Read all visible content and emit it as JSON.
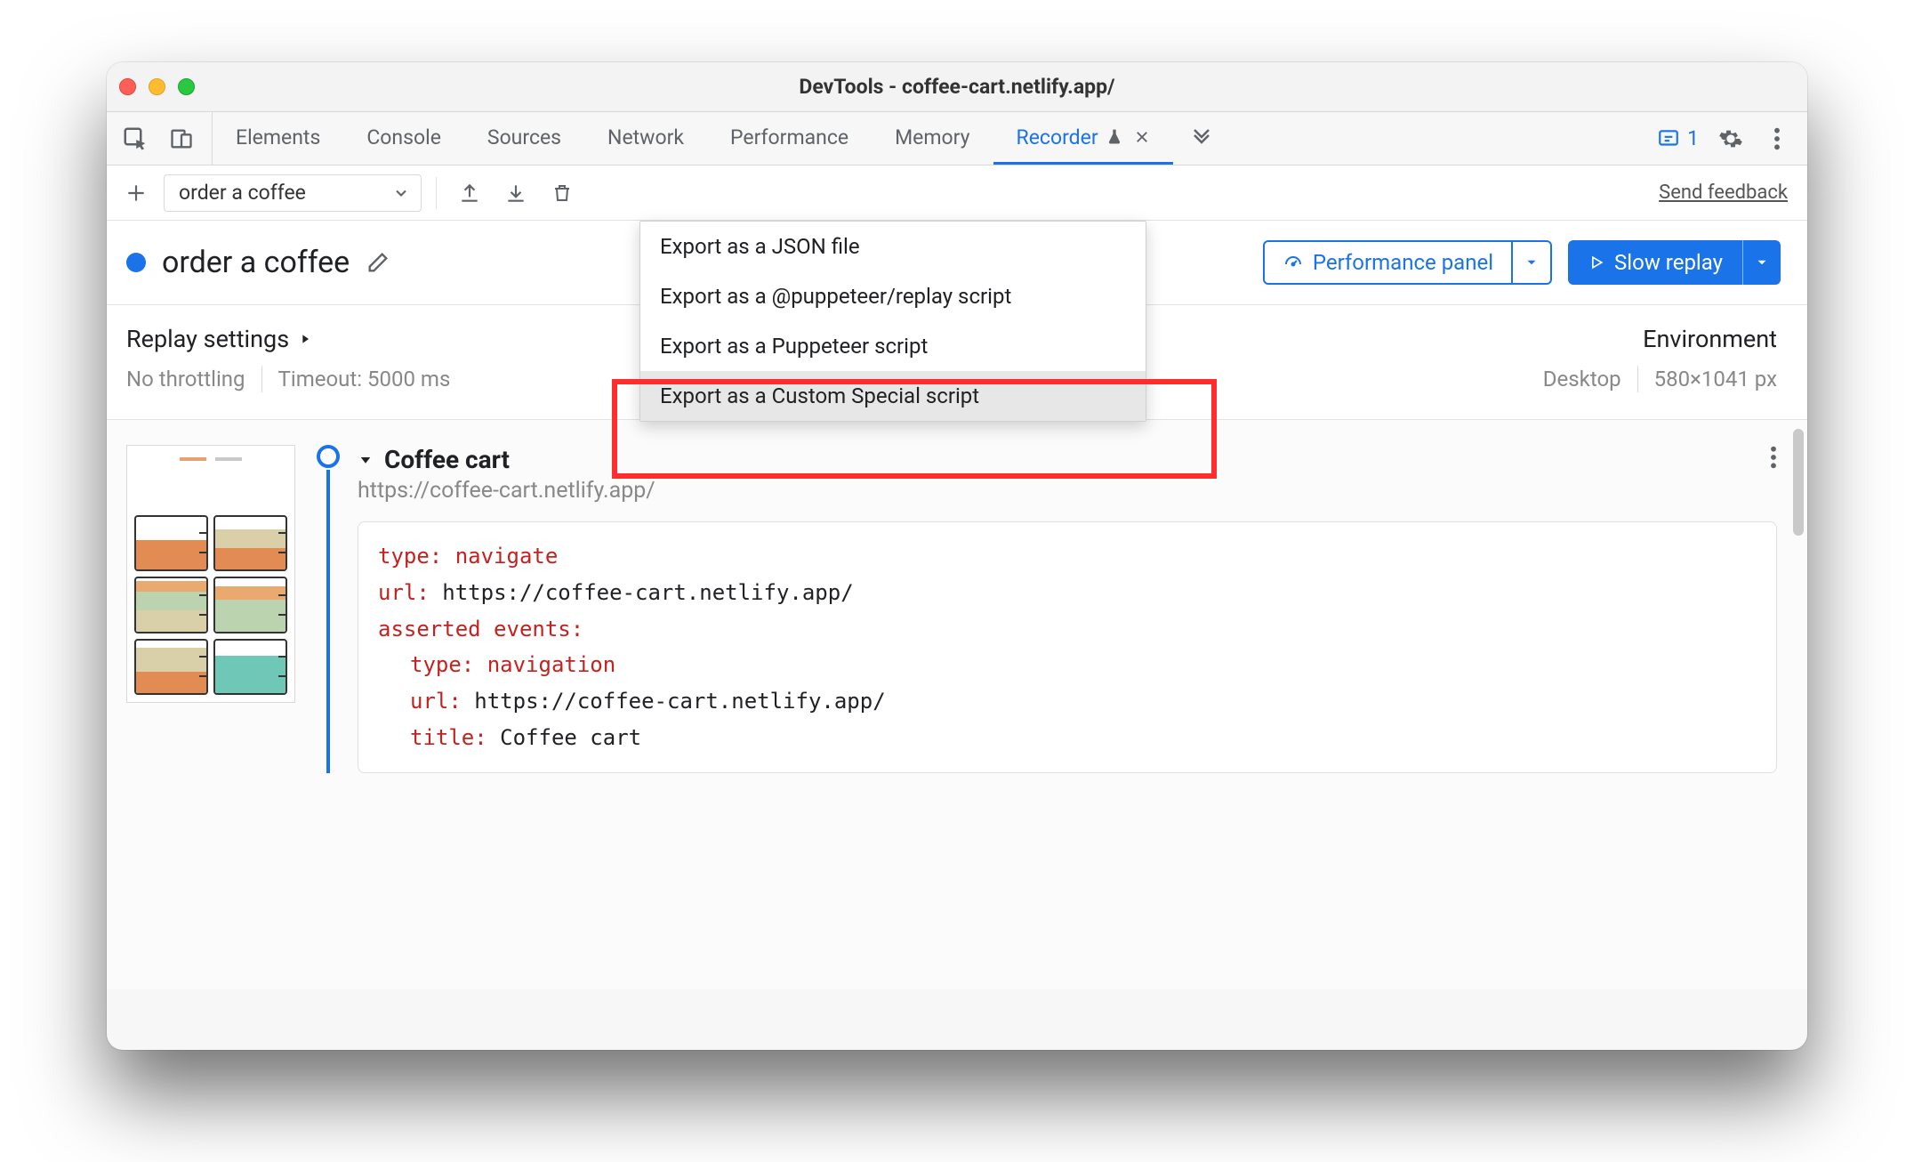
{
  "window": {
    "title": "DevTools - coffee-cart.netlify.app/"
  },
  "tabs": {
    "items": [
      "Elements",
      "Console",
      "Sources",
      "Network",
      "Performance",
      "Memory",
      "Recorder"
    ],
    "active_index": 6,
    "issues_count": "1"
  },
  "toolbar": {
    "recording_select": "order a coffee",
    "send_feedback": "Send feedback"
  },
  "header": {
    "recording_name": "order a coffee",
    "performance_btn": "Performance panel",
    "replay_btn": "Slow replay"
  },
  "settings": {
    "title": "Replay settings",
    "throttling": "No throttling",
    "timeout": "Timeout: 5000 ms"
  },
  "environment": {
    "title": "Environment",
    "device": "Desktop",
    "dimensions": "580×1041 px"
  },
  "export_menu": {
    "items": [
      "Export as a JSON file",
      "Export as a @puppeteer/replay script",
      "Export as a Puppeteer script",
      "Export as a Custom Special script"
    ],
    "highlighted_index": 3
  },
  "step": {
    "title": "Coffee cart",
    "subtitle": "https://coffee-cart.netlify.app/",
    "code": {
      "type_label": "type",
      "type_value": "navigate",
      "url_label": "url",
      "url_value": "https://coffee-cart.netlify.app/",
      "asserted_label": "asserted events",
      "ev_type_label": "type",
      "ev_type_value": "navigation",
      "ev_url_label": "url",
      "ev_url_value": "https://coffee-cart.netlify.app/",
      "ev_title_label": "title",
      "ev_title_value": "Coffee cart"
    }
  }
}
